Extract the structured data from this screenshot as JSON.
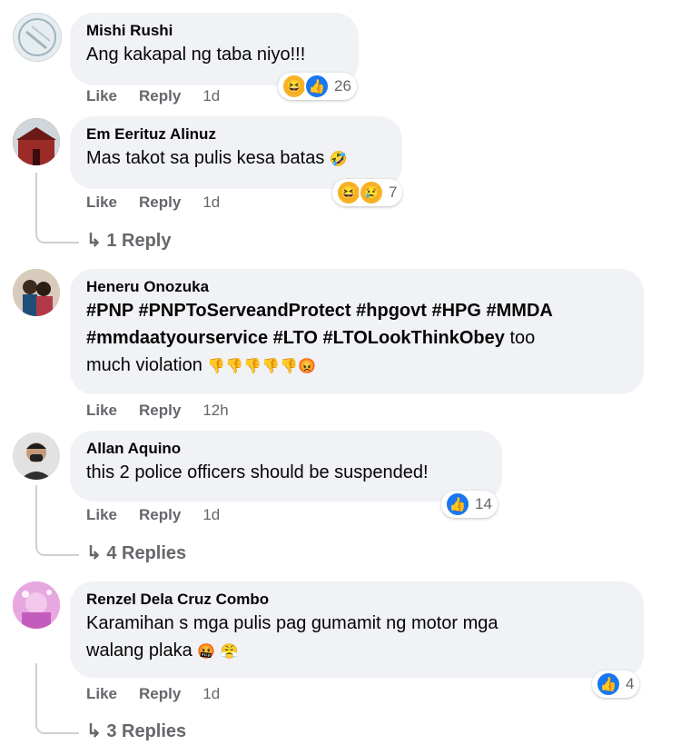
{
  "actions": {
    "like": "Like",
    "reply": "Reply"
  },
  "comments": [
    {
      "name": "Mishi Rushi",
      "text": "Ang kakapal ng taba niyo!!!",
      "time": "1d",
      "reactions": "26"
    },
    {
      "name": "Em Eerituz Alinuz",
      "text": "Mas takot sa pulis kesa batas",
      "time": "1d",
      "reactions": "7",
      "replies": "1 Reply"
    },
    {
      "name": "Heneru Onozuka",
      "line1": "#PNP #PNPToServeandProtect #hpgovt #HPG #MMDA",
      "line2_tags": "#mmdaatyourservice #LTO #LTOLookThinkObey",
      "line2_rest": " too",
      "line3": "much violation",
      "time": "12h"
    },
    {
      "name": "Allan Aquino",
      "text": "this 2 police officers should be suspended!",
      "time": "1d",
      "reactions": "14",
      "replies": "4 Replies"
    },
    {
      "name": "Renzel Dela Cruz Combo",
      "line1": "Karamihan s mga pulis pag gumamit ng motor mga",
      "line2": "walang plaka",
      "time": "1d",
      "reactions": "4",
      "replies": "3 Replies"
    }
  ],
  "colors": {
    "link": "#050505",
    "meta": "#65676b",
    "bubble": "#f0f2f5",
    "like": "#1877f2"
  }
}
